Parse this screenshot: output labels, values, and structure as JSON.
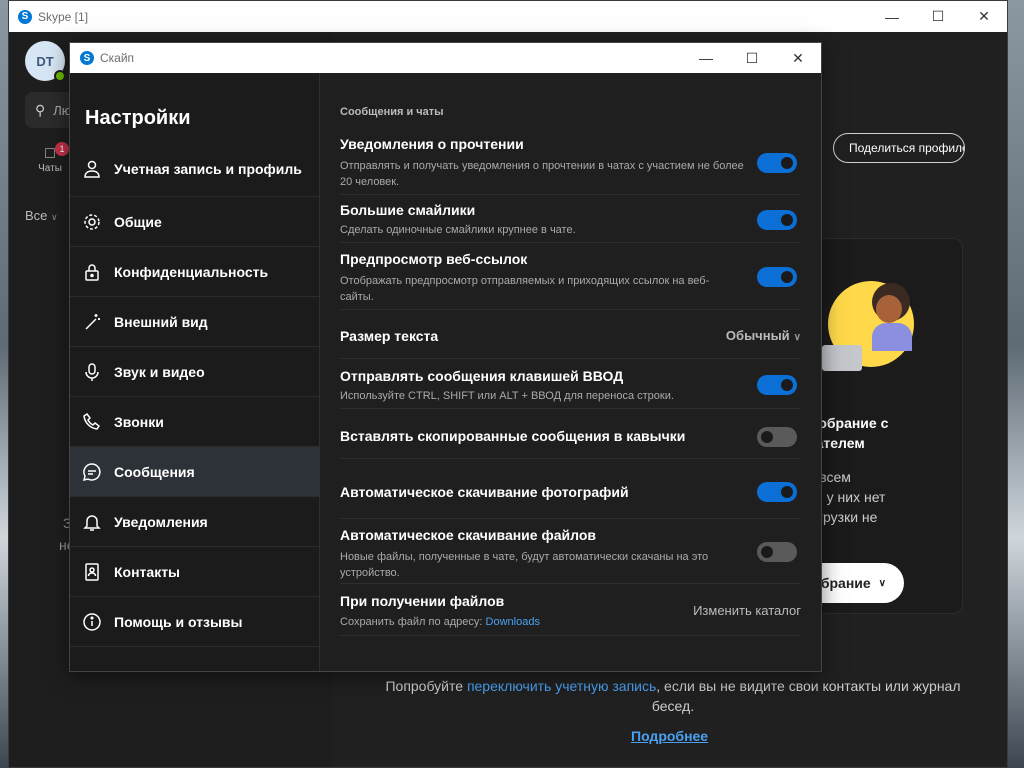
{
  "main_window": {
    "title": "Skype [1]",
    "avatar_initials": "DT",
    "search_placeholder": "Лю",
    "chats_label": "Чаты",
    "chats_badge": "1",
    "filter_label": "Все",
    "left_hidden_line1": "З",
    "left_hidden_line2": "не",
    "share_profile": "Поделиться профиле",
    "meet_title_line1": "те собрание с",
    "meet_title_line2": "зователем",
    "meet_desc_line1": "ние всем",
    "meet_desc_line2": "если у них нет",
    "meet_desc_line3": "и загрузки не",
    "meet_button": "собрание",
    "try_prefix": "Попробуйте ",
    "try_link": "переключить учетную запись",
    "try_suffix": ", если вы не видите свои контакты или журнал бесед.",
    "more_link": "Подробнее"
  },
  "dialog": {
    "title": "Скайп",
    "heading": "Настройки",
    "nav": [
      {
        "label": "Учетная запись и профиль",
        "icon": "person-icon"
      },
      {
        "label": "Общие",
        "icon": "gear-icon"
      },
      {
        "label": "Конфиденциальность",
        "icon": "lock-icon"
      },
      {
        "label": "Внешний вид",
        "icon": "magic-wand-icon"
      },
      {
        "label": "Звук и видео",
        "icon": "microphone-icon"
      },
      {
        "label": "Звонки",
        "icon": "phone-icon"
      },
      {
        "label": "Сообщения",
        "icon": "chat-icon"
      },
      {
        "label": "Уведомления",
        "icon": "bell-icon"
      },
      {
        "label": "Контакты",
        "icon": "contact-book-icon"
      },
      {
        "label": "Помощь и отзывы",
        "icon": "info-icon"
      }
    ],
    "active_nav": "Сообщения",
    "section_title": "Сообщения и чаты",
    "settings": {
      "read_receipts": {
        "label": "Уведомления о прочтении",
        "desc": "Отправлять и получать уведомления о прочтении в чатах с участием не более 20 человек.",
        "enabled": true
      },
      "large_emoticons": {
        "label": "Большие смайлики",
        "desc": "Сделать одиночные смайлики крупнее в чате.",
        "enabled": true
      },
      "web_preview": {
        "label": "Предпросмотр веб-ссылок",
        "desc": "Отображать предпросмотр отправляемых и приходящих ссылок на веб-сайты.",
        "enabled": true
      },
      "text_size": {
        "label": "Размер текста",
        "value": "Обычный"
      },
      "enter_send": {
        "label": "Отправлять сообщения клавишей ВВОД",
        "desc": "Используйте CTRL, SHIFT или ALT + ВВОД для переноса строки.",
        "enabled": true
      },
      "paste_quotes": {
        "label": "Вставлять скопированные сообщения в кавычки",
        "enabled": false
      },
      "auto_photos": {
        "label": "Автоматическое скачивание фотографий",
        "enabled": true
      },
      "auto_files": {
        "label": "Автоматическое скачивание файлов",
        "desc": "Новые файлы, полученные в чате, будут автоматически скачаны на это устройство.",
        "enabled": false
      },
      "receive_files": {
        "label": "При получении файлов",
        "desc_prefix": "Сохранить файл по адресу: ",
        "folder": "Downloads",
        "action": "Изменить каталог"
      }
    }
  },
  "colors": {
    "accent": "#0b6fd6",
    "toggle_off": "#5a5a5a",
    "link": "#4aa0f0",
    "badge": "#c4314b",
    "presence": "#6bb700"
  }
}
